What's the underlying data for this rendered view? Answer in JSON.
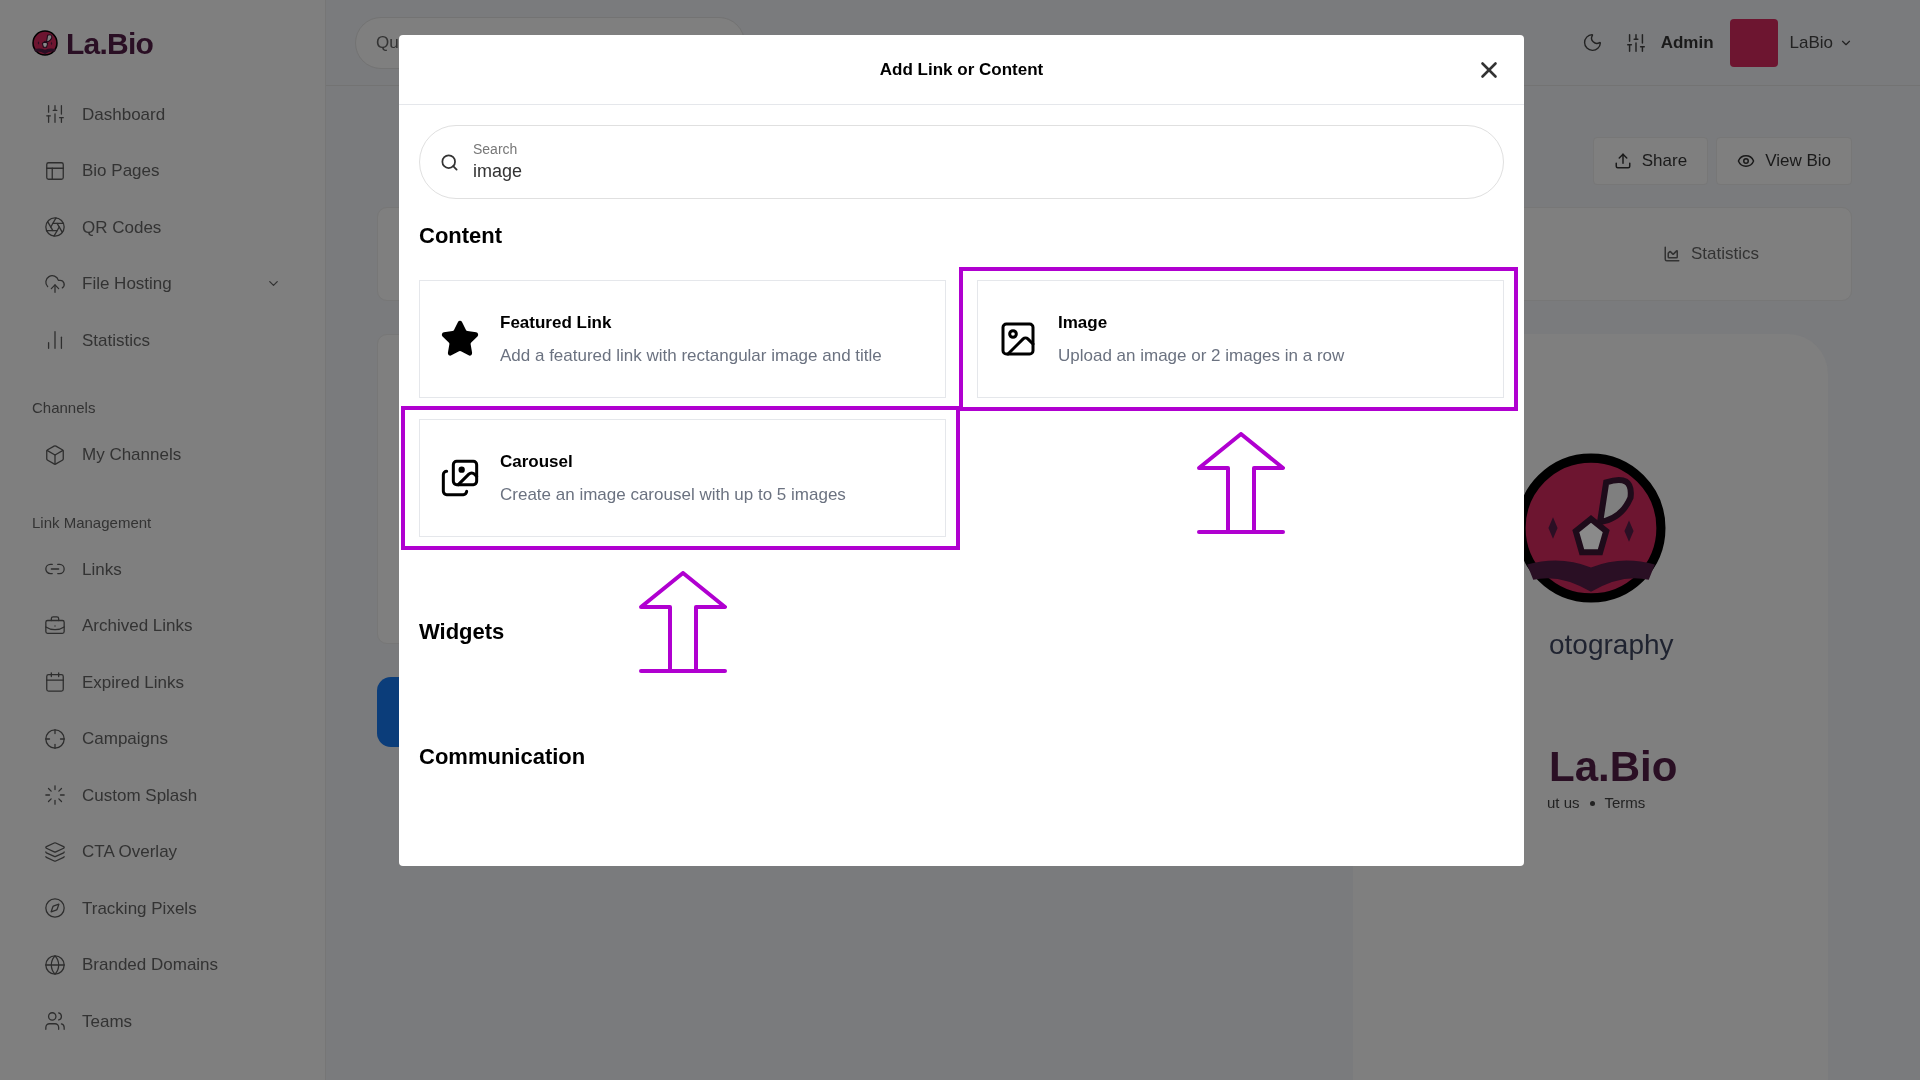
{
  "sidebar": {
    "logo": "La.Bio",
    "sections": [
      {
        "items": [
          {
            "label": "Dashboard"
          },
          {
            "label": "Bio Pages"
          },
          {
            "label": "QR Codes"
          },
          {
            "label": "File Hosting",
            "expanded": false
          },
          {
            "label": "Statistics"
          }
        ]
      },
      {
        "title": "Channels",
        "items": [
          {
            "label": "My Channels"
          }
        ]
      },
      {
        "title": "Link Management",
        "items": [
          {
            "label": "Links"
          },
          {
            "label": "Archived Links"
          },
          {
            "label": "Expired Links"
          },
          {
            "label": "Campaigns"
          },
          {
            "label": "Custom Splash"
          },
          {
            "label": "CTA Overlay"
          },
          {
            "label": "Tracking Pixels"
          },
          {
            "label": "Branded Domains"
          },
          {
            "label": "Teams"
          }
        ]
      }
    ]
  },
  "header": {
    "search": {
      "placeholder": "Qu"
    },
    "role": "Admin",
    "user": "LaBio"
  },
  "toolbar": {
    "buttons": [
      "Share",
      "View Bio"
    ]
  },
  "tabs_card": {
    "tab": "Statistics"
  },
  "preview": {
    "title": "otography",
    "brand": "La.Bio",
    "footer_links": [
      "ut us",
      "Terms"
    ]
  },
  "modal": {
    "title": "Add Link or Content",
    "search": {
      "label": "Search",
      "value": "image"
    },
    "sections": [
      {
        "title": "Content",
        "items": [
          {
            "title": "Featured Link",
            "description": "Add a featured link with rectangular image and title",
            "highlighted": false
          },
          {
            "title": "Image",
            "description": "Upload an image or 2 images in a row",
            "highlighted": true
          },
          {
            "title": "Carousel",
            "description": "Create an image carousel with up to 5 images",
            "highlighted": true
          }
        ]
      },
      {
        "title": "Widgets"
      },
      {
        "title": "Communication"
      }
    ]
  }
}
